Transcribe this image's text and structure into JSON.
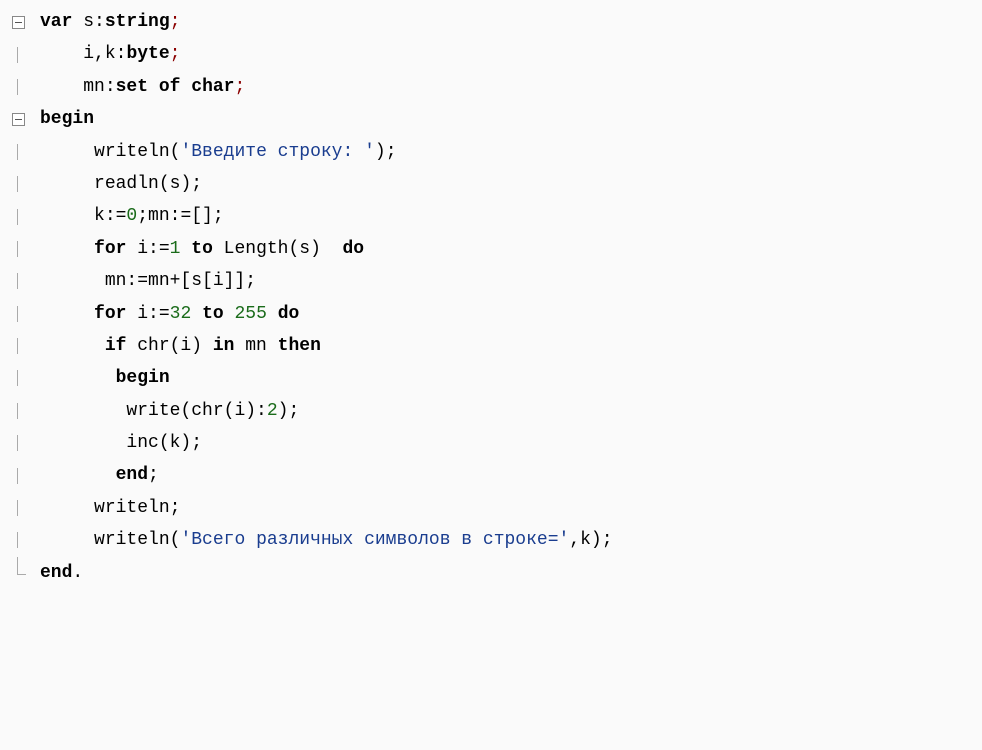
{
  "code": {
    "l1_kw1": "var",
    "l1_id": " s:",
    "l1_kw2": "string",
    "l1_p": ";",
    "l2_txt": "i,k:",
    "l2_kw": "byte",
    "l2_p": ";",
    "l3_txt1": "mn:",
    "l3_kw1": "set",
    "l3_txt2": " ",
    "l3_kw2": "of",
    "l3_txt3": " ",
    "l3_kw3": "char",
    "l3_p": ";",
    "l4_kw": "begin",
    "l5_fn": "writeln",
    "l5_p1": "(",
    "l5_str": "'Введите строку: '",
    "l5_p2": ");",
    "l6_fn": "readln",
    "l6_p1": "(",
    "l6_arg": "s",
    "l6_p2": ");",
    "l7_txt": "k:=",
    "l7_n1": "0",
    "l7_p1": ";",
    "l7_txt2": "mn:=[]",
    "l7_p2": ";",
    "l8_kw1": "for",
    "l8_txt1": " i:=",
    "l8_n1": "1",
    "l8_txt2": " ",
    "l8_kw2": "to",
    "l8_txt3": " Length(s)  ",
    "l8_kw3": "do",
    "l9_txt": "mn:=mn+[s[i]];",
    "l10_kw1": "for",
    "l10_txt1": " i:=",
    "l10_n1": "32",
    "l10_txt2": " ",
    "l10_kw2": "to",
    "l10_txt3": " ",
    "l10_n2": "255",
    "l10_txt4": " ",
    "l10_kw3": "do",
    "l11_kw1": "if",
    "l11_txt1": " chr(i) ",
    "l11_kw2": "in",
    "l11_txt2": " mn ",
    "l11_kw3": "then",
    "l12_kw": "begin",
    "l13_fn": "write",
    "l13_p1": "(chr(i):",
    "l13_n": "2",
    "l13_p2": ");",
    "l14_fn": "inc",
    "l14_p": "(k);",
    "l15_kw": "end",
    "l15_p": ";",
    "l16_fn": "writeln",
    "l16_p": ";",
    "l17_fn": "writeln",
    "l17_p1": "(",
    "l17_str": "'Всего различных символов в строке='",
    "l17_p2": ",k);",
    "l18_kw": "end",
    "l18_p": "."
  }
}
